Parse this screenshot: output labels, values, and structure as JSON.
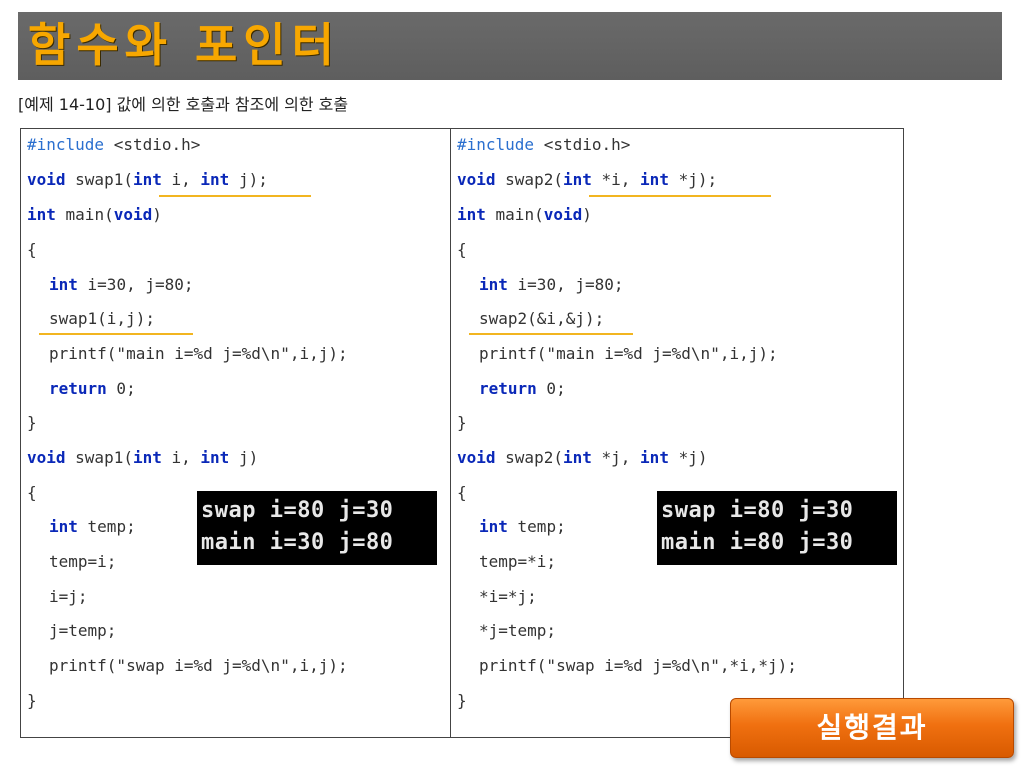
{
  "header": {
    "title": "함수와 포인터"
  },
  "caption": "[예제 14-10] 값에 의한 호출과 참조에 의한 호출",
  "left_code": {
    "l1": {
      "pp": "#include",
      "t": " <stdio.h>"
    },
    "l2": {
      "k1": "void",
      "t1": " swap1(",
      "k2": "int",
      "t2": " i, ",
      "k3": "int",
      "t3": " j);"
    },
    "l3": {
      "k1": "int",
      "t1": " main(",
      "k2": "void",
      "t2": ")"
    },
    "l4": "{",
    "l5": {
      "k1": "int",
      "t1": " i=30, j=80;"
    },
    "l6": "swap1(i,j);",
    "l7": "printf(\"main i=%d j=%d\\n\",i,j);",
    "l8": {
      "k1": "return",
      "t1": " 0;"
    },
    "l9": "}",
    "l10": {
      "k1": "void",
      "t1": " swap1(",
      "k2": "int",
      "t2": " i, ",
      "k3": "int",
      "t3": " j)"
    },
    "l11": "{",
    "l12": {
      "k1": "int",
      "t1": " temp;"
    },
    "l13": "temp=i;",
    "l14": "i=j;",
    "l15": "j=temp;",
    "l16": "printf(\"swap i=%d j=%d\\n\",i,j);",
    "l17": "}"
  },
  "right_code": {
    "l1": {
      "pp": "#include",
      "t": " <stdio.h>"
    },
    "l2": {
      "k1": "void",
      "t1": " swap2(",
      "k2": "int",
      "t2": " *i, ",
      "k3": "int",
      "t3": " *j);"
    },
    "l3": {
      "k1": "int",
      "t1": " main(",
      "k2": "void",
      "t2": ")"
    },
    "l4": "{",
    "l5": {
      "k1": "int",
      "t1": " i=30, j=80;"
    },
    "l6": "swap2(&i,&j);",
    "l7": "printf(\"main i=%d j=%d\\n\",i,j);",
    "l8": {
      "k1": "return",
      "t1": " 0;"
    },
    "l9": "}",
    "l10": {
      "k1": "void",
      "t1": " swap2(",
      "k2": "int",
      "t2": " *j, ",
      "k3": "int",
      "t3": " *j)"
    },
    "l11": "{",
    "l12": {
      "k1": "int",
      "t1": " temp;"
    },
    "l13": "temp=*i;",
    "l14": "*i=*j;",
    "l15": "*j=temp;",
    "l16": "printf(\"swap i=%d j=%d\\n\",*i,*j);",
    "l17": "}"
  },
  "console_left": [
    "swap i=80 j=30",
    "main i=30 j=80"
  ],
  "console_right": [
    "swap i=80 j=30",
    "main i=80 j=30"
  ],
  "result_button": {
    "label": "실행결과"
  },
  "colors": {
    "title_text": "#f7a700",
    "title_bg": "#636363",
    "keyword": "#0a28b8",
    "preprocessor": "#2a6fcf",
    "underline": "#f2b520",
    "button": "#f07010"
  }
}
